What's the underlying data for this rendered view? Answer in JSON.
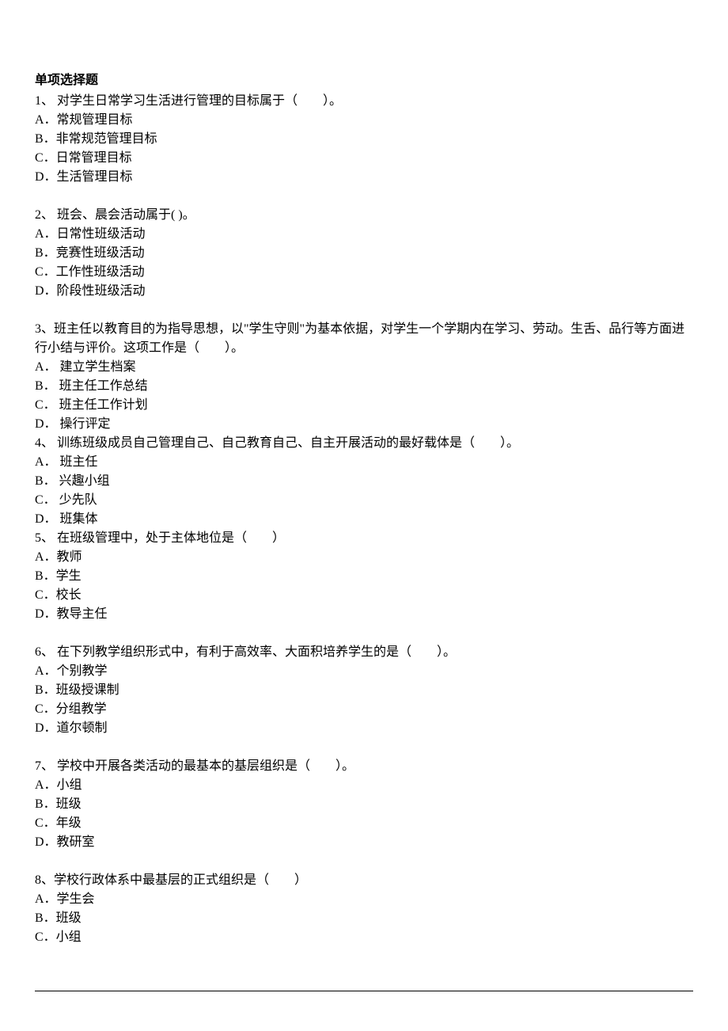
{
  "title": "单项选择题",
  "questions": [
    {
      "stem": "1、 对学生日常学习生活进行管理的目标属于（　　）。",
      "options": [
        "A．常规管理目标",
        "B．非常规范管理目标",
        "C．日常管理目标",
        "D．生活管理目标"
      ]
    },
    {
      "stem": "2、 班会、晨会活动属于( )。",
      "options": [
        "A．日常性班级活动",
        "B．竞赛性班级活动",
        "C．工作性班级活动",
        "D．阶段性班级活动"
      ]
    },
    {
      "stem": "3、班主任以教育目的为指导思想，以\"学生守则\"为基本依据，对学生一个学期内在学习、劳动。生舌、品行等方面进行小结与评价。这项工作是（　　）。",
      "options": [
        "A．  建立学生档案",
        "B．  班主任工作总结",
        "C．  班主任工作计划",
        "D．  操行评定"
      ]
    },
    {
      "stem": "4、 训练班级成员自己管理自己、自己教育自己、自主开展活动的最好载体是（　　）。",
      "options": [
        "A．  班主任",
        "B．  兴趣小组",
        "C．  少先队",
        "D．  班集体"
      ]
    },
    {
      "stem": "5、 在班级管理中，处于主体地位是（　　）",
      "options": [
        "A．教师",
        "B．学生",
        "C．校长",
        "D．教导主任"
      ]
    },
    {
      "stem": "6、 在下列教学组织形式中，有利于高效率、大面积培养学生的是（　　）。",
      "options": [
        "A．个别教学",
        "B．班级授课制",
        "C．分组教学",
        "D．道尔顿制"
      ]
    },
    {
      "stem": "7、 学校中开展各类活动的最基本的基层组织是（　　）。",
      "options": [
        "A．小组",
        "B．班级",
        "C．年级",
        "D．教研室"
      ]
    },
    {
      "stem": "8、学校行政体系中最基层的正式组织是（　　）",
      "options": [
        "A．学生会",
        "B．班级",
        "C．小组"
      ]
    }
  ]
}
